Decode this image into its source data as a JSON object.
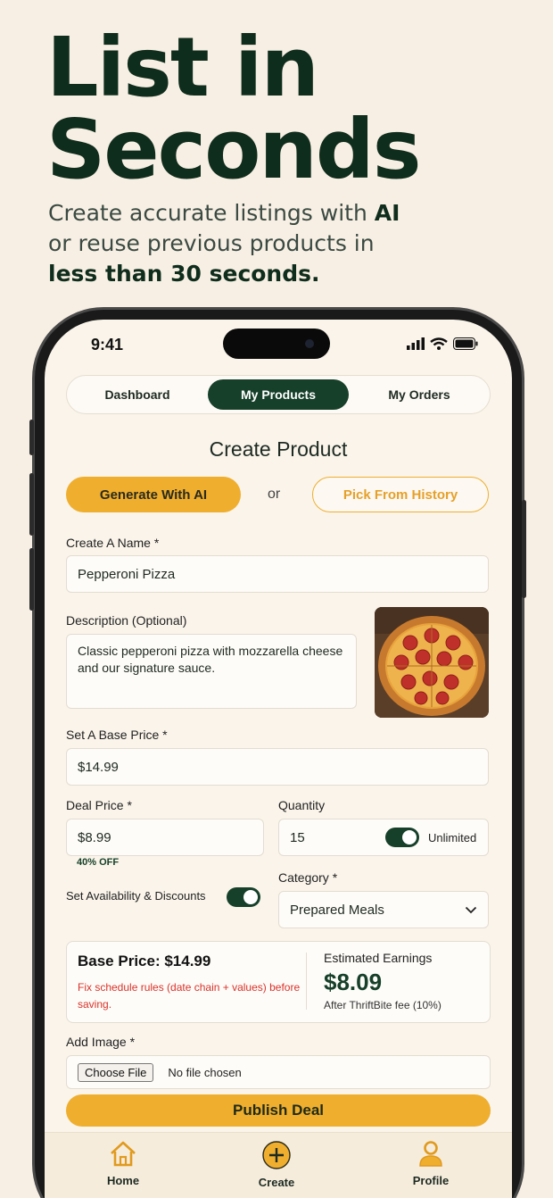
{
  "hero": {
    "title_line1": "List in",
    "title_line2": "Seconds",
    "sub_part1": "Create accurate listings with ",
    "sub_bold1": "AI",
    "sub_part2": " or reuse previous products in ",
    "sub_bold2": "less than 30 seconds."
  },
  "status": {
    "time": "9:41"
  },
  "tabs": [
    {
      "label": "Dashboard",
      "active": false
    },
    {
      "label": "My Products",
      "active": true
    },
    {
      "label": "My Orders",
      "active": false
    }
  ],
  "form": {
    "title": "Create Product",
    "generate_label": "Generate With AI",
    "or_label": "or",
    "history_label": "Pick From History",
    "name_label": "Create A Name *",
    "name_value": "Pepperoni Pizza",
    "description_label": "Description (Optional)",
    "description_value": "Classic pepperoni pizza with mozzarella cheese and our signature sauce.",
    "base_price_label": "Set A Base Price *",
    "base_price_value": "$14.99",
    "deal_price_label": "Deal Price *",
    "deal_price_value": "$8.99",
    "discount_badge": "40% OFF",
    "quantity_label": "Quantity",
    "quantity_value": "15",
    "unlimited_label": "Unlimited",
    "unlimited_on": true,
    "availability_label": "Set Availability & Discounts",
    "availability_on": true,
    "category_label": "Category *",
    "category_value": "Prepared Meals"
  },
  "summary": {
    "base_price": "Base Price: $14.99",
    "warning": "Fix schedule rules (date chain + values) before saving.",
    "estimated_label": "Estimated Earnings",
    "estimated_value": "$8.09",
    "fee_note": "After ThriftBite fee (10%)"
  },
  "image": {
    "label": "Add Image *",
    "choose_label": "Choose File",
    "no_file": "No file chosen"
  },
  "publish_label": "Publish Deal",
  "nav": [
    {
      "label": "Home",
      "icon": "home-icon"
    },
    {
      "label": "Create",
      "icon": "plus-circle-icon"
    },
    {
      "label": "Profile",
      "icon": "person-icon"
    }
  ],
  "colors": {
    "accent": "#efae2e",
    "brand_green": "#16402a",
    "warning_red": "#d9322b",
    "background": "#f8efe4"
  }
}
